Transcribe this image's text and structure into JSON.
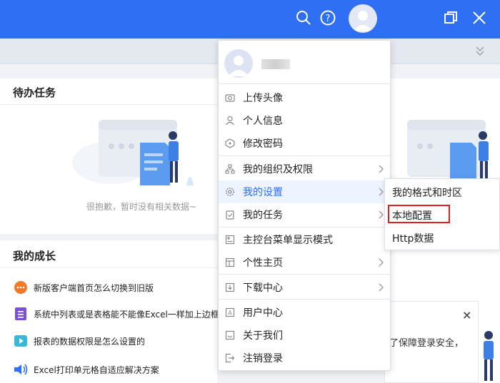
{
  "topbar": {
    "icons": [
      "search-icon",
      "help-icon",
      "user-avatar",
      "restore-window-icon",
      "close-icon"
    ],
    "bg_color": "#2f6ff3"
  },
  "todo": {
    "title": "待办任务",
    "empty_text": "很抱歉，暂时没有相关数据~"
  },
  "growth": {
    "title": "我的成长",
    "items": [
      {
        "text": "新版客户端首页怎么切换到旧版",
        "icon": "chat-bubble-icon"
      },
      {
        "text": "系统中列表或是表格能不能像Excel一样加上边框",
        "icon": "document-list-icon"
      },
      {
        "text": "报表的数据权限是怎么设置的",
        "icon": "video-play-icon"
      },
      {
        "text": "Excel打印单元格自适应解决方案",
        "icon": "speaker-icon"
      }
    ]
  },
  "notice": {
    "close": "×",
    "text": "了保障登录安全，"
  },
  "menu": {
    "items": [
      {
        "label": "上传头像",
        "icon": "camera-icon"
      },
      {
        "label": "个人信息",
        "icon": "person-icon"
      },
      {
        "label": "修改密码",
        "icon": "password-icon"
      },
      {
        "label": "我的组织及权限",
        "icon": "org-chart-icon"
      },
      {
        "label": "我的设置",
        "icon": "gear-icon"
      },
      {
        "label": "我的任务",
        "icon": "task-icon"
      },
      {
        "label": "主控台菜单显示模式",
        "icon": "layout-icon"
      },
      {
        "label": "个性主页",
        "icon": "homepage-icon"
      },
      {
        "label": "下载中心",
        "icon": "download-icon"
      },
      {
        "label": "用户中心",
        "icon": "user-center-icon"
      },
      {
        "label": "关于我们",
        "icon": "about-icon"
      },
      {
        "label": "注销登录",
        "icon": "logout-icon"
      }
    ]
  },
  "submenu": {
    "items": [
      "我的格式和时区",
      "本地配置",
      "Http数据"
    ]
  },
  "colors": {
    "accent": "#2f6ff3",
    "highlight": "#e02020"
  }
}
